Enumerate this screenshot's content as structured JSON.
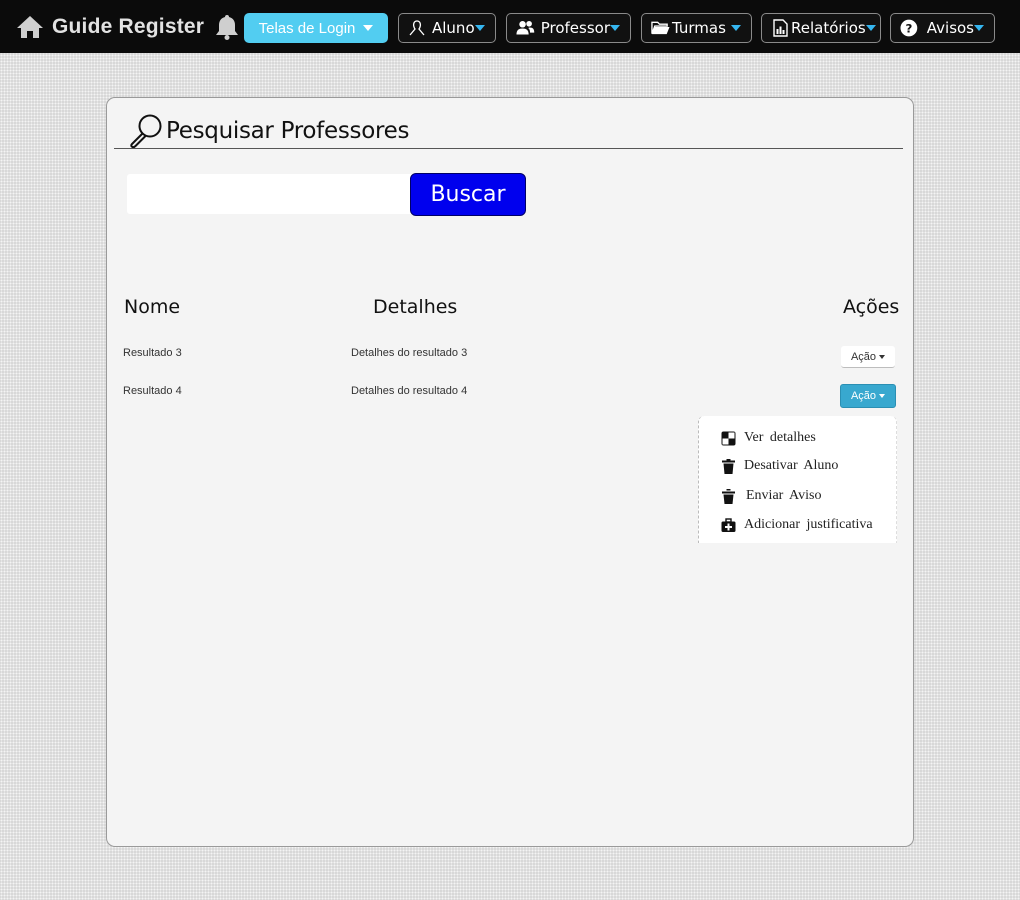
{
  "app": {
    "title": "Guide Register"
  },
  "nav": {
    "login": "Telas de Login",
    "aluno": "Aluno",
    "professor": "Professor",
    "turmas": "Turmas",
    "relatorios": "Relatórios",
    "avisos": "Avisos"
  },
  "page": {
    "title": "Pesquisar Professores"
  },
  "search": {
    "value": "",
    "placeholder": "",
    "button": "Buscar"
  },
  "table": {
    "headers": {
      "nome": "Nome",
      "detalhes": "Detalhes",
      "acoes": "Ações"
    },
    "rows": [
      {
        "nome": "Resultado 3",
        "detalhes": "Detalhes do resultado 3",
        "acao": "Ação"
      },
      {
        "nome": "Resultado 4",
        "detalhes": "Detalhes do resultado 4",
        "acao": "Ação"
      }
    ]
  },
  "menu": {
    "ver": "Ver detalhes",
    "desativar": "Desativar Aluno",
    "aviso": "Enviar Aviso",
    "justificativa": "Adicionar justificativa"
  },
  "colors": {
    "topbar": "#0b0b0b",
    "login_button": "#52cdf1",
    "search_button": "#0000ee",
    "action_active": "#38a8cf",
    "caret": "#35b6f0"
  },
  "icons": [
    "home-icon",
    "bell-icon",
    "user-icon",
    "users-icon",
    "folder-icon",
    "report-icon",
    "help-icon",
    "magnifier-icon",
    "checker-icon",
    "trash-icon",
    "upload-trash-icon",
    "medkit-icon"
  ]
}
